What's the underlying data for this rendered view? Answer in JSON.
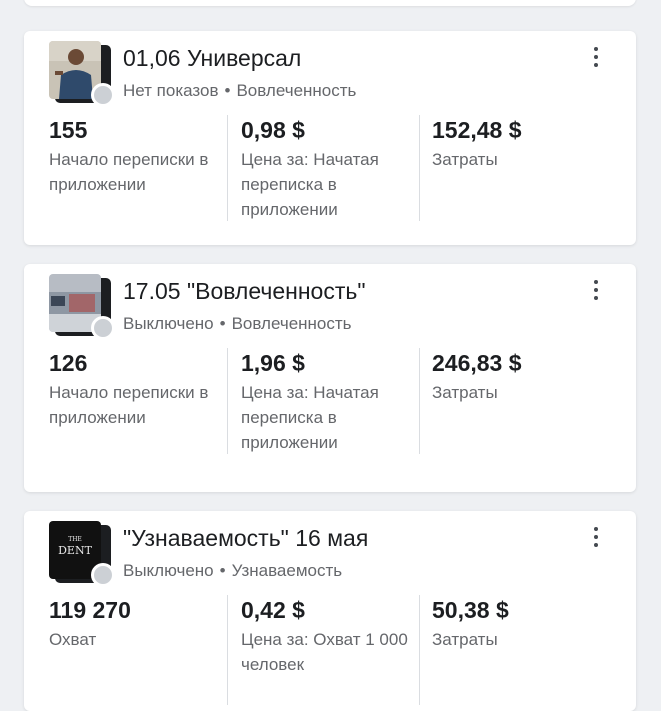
{
  "campaigns": [
    {
      "title": "01,06 Универсал",
      "status": "Нет показов",
      "objective": "Вовлеченность",
      "metrics": [
        {
          "value": "155",
          "label": "Начало переписки в приложении"
        },
        {
          "value": "0,98 $",
          "label": "Цена за: Начатая переписка в приложении"
        },
        {
          "value": "152,48 $",
          "label": "Затраты"
        }
      ]
    },
    {
      "title": "17.05 \"Вовлеченность\"",
      "status": "Выключено",
      "objective": "Вовлеченность",
      "metrics": [
        {
          "value": "126",
          "label": "Начало переписки в приложении"
        },
        {
          "value": "1,96 $",
          "label": "Цена за: Начатая переписка в приложении"
        },
        {
          "value": "246,83 $",
          "label": "Затраты"
        }
      ]
    },
    {
      "title": "\"Узнаваемость\" 16 мая",
      "status": "Выключено",
      "objective": "Узнаваемость",
      "thumb_text": "THE DENT",
      "metrics": [
        {
          "value": "119 270",
          "label": "Охват"
        },
        {
          "value": "0,42 $",
          "label": "Цена за: Охват 1 000 человек"
        },
        {
          "value": "50,38 $",
          "label": "Затраты"
        }
      ]
    }
  ],
  "separator": "•",
  "colors": {
    "status_dot": "#ccd0d5",
    "text_primary": "#1c1e21",
    "text_secondary": "#65676b",
    "background": "#eef0f3"
  },
  "icons": {
    "more": "more-vertical-icon"
  }
}
